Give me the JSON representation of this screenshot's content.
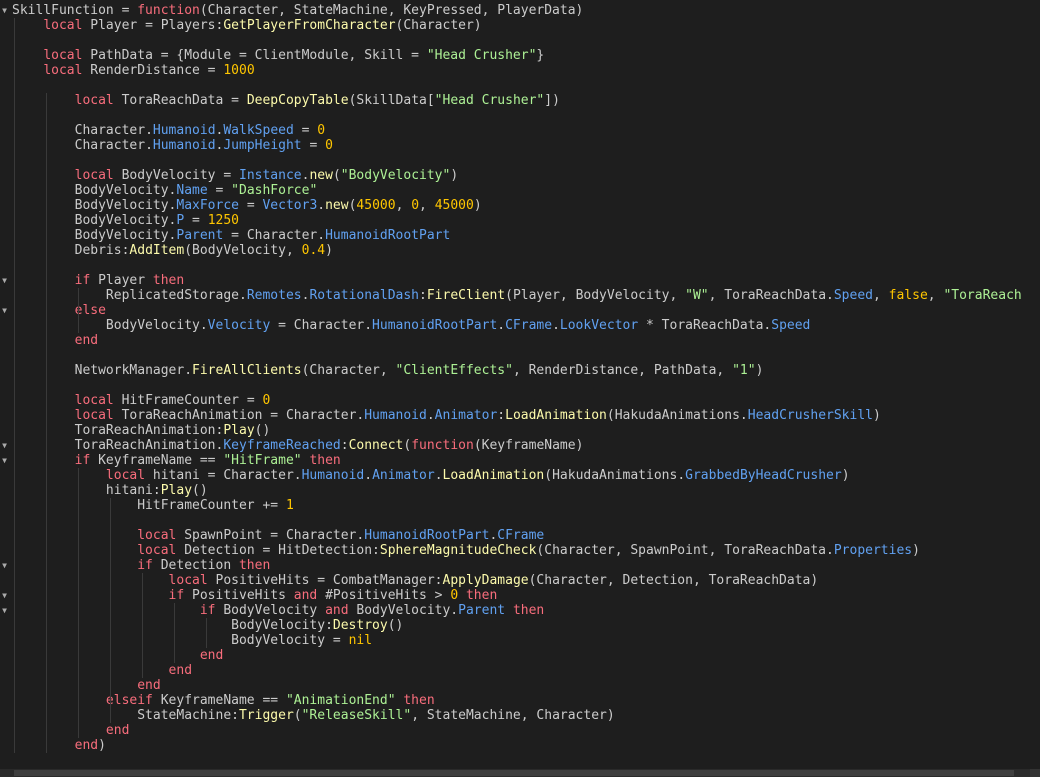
{
  "editor": {
    "colors": {
      "background": "#1e1e1e",
      "text": "#cccccc",
      "keyword": "#f86d7c",
      "function": "#fdfbac",
      "property": "#61a1f1",
      "string": "#adf195",
      "number": "#ffc600"
    },
    "fold_icon": "fold-arrow-icon",
    "lines": [
      {
        "indent": 0,
        "fold": true,
        "tokens": [
          [
            "SkillFunction = ",
            "t"
          ],
          [
            "function",
            "k"
          ],
          [
            "(Character, StateMachine, KeyPressed, PlayerData)",
            "t"
          ]
        ]
      },
      {
        "indent": 1,
        "tokens": [
          [
            "local",
            "k"
          ],
          [
            " Player = Players:",
            "t"
          ],
          [
            "GetPlayerFromCharacter",
            "f"
          ],
          [
            "(Character)",
            "t"
          ]
        ]
      },
      {
        "indent": 0,
        "tokens": []
      },
      {
        "indent": 1,
        "tokens": [
          [
            "local",
            "k"
          ],
          [
            " PathData = {Module = ClientModule, Skill = ",
            "t"
          ],
          [
            "\"Head Crusher\"",
            "s"
          ],
          [
            "}",
            "t"
          ]
        ]
      },
      {
        "indent": 1,
        "tokens": [
          [
            "local",
            "k"
          ],
          [
            " RenderDistance = ",
            "t"
          ],
          [
            "1000",
            "n"
          ]
        ]
      },
      {
        "indent": 0,
        "tokens": []
      },
      {
        "indent": 2,
        "tokens": [
          [
            "local",
            "k"
          ],
          [
            " ToraReachData = ",
            "t"
          ],
          [
            "DeepCopyTable",
            "f"
          ],
          [
            "(SkillData[",
            "t"
          ],
          [
            "\"Head Crusher\"",
            "s"
          ],
          [
            "])",
            "t"
          ]
        ]
      },
      {
        "indent": 0,
        "tokens": []
      },
      {
        "indent": 2,
        "tokens": [
          [
            "Character.",
            "t"
          ],
          [
            "Humanoid",
            "p"
          ],
          [
            ".",
            "t"
          ],
          [
            "WalkSpeed",
            "p"
          ],
          [
            " = ",
            "t"
          ],
          [
            "0",
            "n"
          ]
        ]
      },
      {
        "indent": 2,
        "tokens": [
          [
            "Character.",
            "t"
          ],
          [
            "Humanoid",
            "p"
          ],
          [
            ".",
            "t"
          ],
          [
            "JumpHeight",
            "p"
          ],
          [
            " = ",
            "t"
          ],
          [
            "0",
            "n"
          ]
        ]
      },
      {
        "indent": 0,
        "tokens": []
      },
      {
        "indent": 2,
        "tokens": [
          [
            "local",
            "k"
          ],
          [
            " BodyVelocity = ",
            "t"
          ],
          [
            "Instance",
            "p"
          ],
          [
            ".",
            "t"
          ],
          [
            "new",
            "f"
          ],
          [
            "(",
            "t"
          ],
          [
            "\"BodyVelocity\"",
            "s"
          ],
          [
            ")",
            "t"
          ]
        ]
      },
      {
        "indent": 2,
        "tokens": [
          [
            "BodyVelocity.",
            "t"
          ],
          [
            "Name",
            "p"
          ],
          [
            " = ",
            "t"
          ],
          [
            "\"DashForce\"",
            "s"
          ]
        ]
      },
      {
        "indent": 2,
        "tokens": [
          [
            "BodyVelocity.",
            "t"
          ],
          [
            "MaxForce",
            "p"
          ],
          [
            " = ",
            "t"
          ],
          [
            "Vector3",
            "p"
          ],
          [
            ".",
            "t"
          ],
          [
            "new",
            "f"
          ],
          [
            "(",
            "t"
          ],
          [
            "45000",
            "n"
          ],
          [
            ", ",
            "t"
          ],
          [
            "0",
            "n"
          ],
          [
            ", ",
            "t"
          ],
          [
            "45000",
            "n"
          ],
          [
            ")",
            "t"
          ]
        ]
      },
      {
        "indent": 2,
        "tokens": [
          [
            "BodyVelocity.",
            "t"
          ],
          [
            "P",
            "p"
          ],
          [
            " = ",
            "t"
          ],
          [
            "1250",
            "n"
          ]
        ]
      },
      {
        "indent": 2,
        "tokens": [
          [
            "BodyVelocity.",
            "t"
          ],
          [
            "Parent",
            "p"
          ],
          [
            " = Character.",
            "t"
          ],
          [
            "HumanoidRootPart",
            "p"
          ]
        ]
      },
      {
        "indent": 2,
        "tokens": [
          [
            "Debris:",
            "t"
          ],
          [
            "AddItem",
            "f"
          ],
          [
            "(BodyVelocity, ",
            "t"
          ],
          [
            "0.4",
            "n"
          ],
          [
            ")",
            "t"
          ]
        ]
      },
      {
        "indent": 0,
        "tokens": []
      },
      {
        "indent": 2,
        "fold": true,
        "tokens": [
          [
            "if",
            "k"
          ],
          [
            " Player ",
            "t"
          ],
          [
            "then",
            "k"
          ]
        ]
      },
      {
        "indent": 3,
        "tokens": [
          [
            "ReplicatedStorage.",
            "t"
          ],
          [
            "Remotes",
            "p"
          ],
          [
            ".",
            "t"
          ],
          [
            "RotationalDash",
            "p"
          ],
          [
            ":",
            "t"
          ],
          [
            "FireClient",
            "f"
          ],
          [
            "(Player, BodyVelocity, ",
            "t"
          ],
          [
            "\"W\"",
            "s"
          ],
          [
            ", ToraReachData.",
            "t"
          ],
          [
            "Speed",
            "p"
          ],
          [
            ", ",
            "t"
          ],
          [
            "false",
            "n"
          ],
          [
            ", ",
            "t"
          ],
          [
            "\"ToraReach",
            "s"
          ]
        ]
      },
      {
        "indent": 2,
        "fold": true,
        "tokens": [
          [
            "else",
            "k"
          ]
        ]
      },
      {
        "indent": 3,
        "tokens": [
          [
            "BodyVelocity.",
            "t"
          ],
          [
            "Velocity",
            "p"
          ],
          [
            " = Character.",
            "t"
          ],
          [
            "HumanoidRootPart",
            "p"
          ],
          [
            ".",
            "t"
          ],
          [
            "CFrame",
            "p"
          ],
          [
            ".",
            "t"
          ],
          [
            "LookVector",
            "p"
          ],
          [
            " * ToraReachData.",
            "t"
          ],
          [
            "Speed",
            "p"
          ]
        ]
      },
      {
        "indent": 2,
        "tokens": [
          [
            "end",
            "k"
          ]
        ]
      },
      {
        "indent": 0,
        "tokens": []
      },
      {
        "indent": 2,
        "tokens": [
          [
            "NetworkManager.",
            "t"
          ],
          [
            "FireAllClients",
            "f"
          ],
          [
            "(Character, ",
            "t"
          ],
          [
            "\"ClientEffects\"",
            "s"
          ],
          [
            ", RenderDistance, PathData, ",
            "t"
          ],
          [
            "\"1\"",
            "s"
          ],
          [
            ")",
            "t"
          ]
        ]
      },
      {
        "indent": 0,
        "tokens": []
      },
      {
        "indent": 2,
        "tokens": [
          [
            "local",
            "k"
          ],
          [
            " HitFrameCounter = ",
            "t"
          ],
          [
            "0",
            "n"
          ]
        ]
      },
      {
        "indent": 2,
        "tokens": [
          [
            "local",
            "k"
          ],
          [
            " ToraReachAnimation = Character.",
            "t"
          ],
          [
            "Humanoid",
            "p"
          ],
          [
            ".",
            "t"
          ],
          [
            "Animator",
            "p"
          ],
          [
            ":",
            "t"
          ],
          [
            "LoadAnimation",
            "f"
          ],
          [
            "(HakudaAnimations.",
            "t"
          ],
          [
            "HeadCrusherSkill",
            "p"
          ],
          [
            ")",
            "t"
          ]
        ]
      },
      {
        "indent": 2,
        "tokens": [
          [
            "ToraReachAnimation:",
            "t"
          ],
          [
            "Play",
            "f"
          ],
          [
            "()",
            "t"
          ]
        ]
      },
      {
        "indent": 2,
        "fold": true,
        "tokens": [
          [
            "ToraReachAnimation.",
            "t"
          ],
          [
            "KeyframeReached",
            "p"
          ],
          [
            ":",
            "t"
          ],
          [
            "Connect",
            "f"
          ],
          [
            "(",
            "t"
          ],
          [
            "function",
            "k"
          ],
          [
            "(KeyframeName)",
            "t"
          ]
        ]
      },
      {
        "indent": 2,
        "fold": true,
        "tokens": [
          [
            "if",
            "k"
          ],
          [
            " KeyframeName == ",
            "t"
          ],
          [
            "\"HitFrame\"",
            "s"
          ],
          [
            " ",
            "t"
          ],
          [
            "then",
            "k"
          ]
        ]
      },
      {
        "indent": 3,
        "tokens": [
          [
            "local",
            "k"
          ],
          [
            " hitani = Character.",
            "t"
          ],
          [
            "Humanoid",
            "p"
          ],
          [
            ".",
            "t"
          ],
          [
            "Animator",
            "p"
          ],
          [
            ".",
            "t"
          ],
          [
            "LoadAnimation",
            "f"
          ],
          [
            "(HakudaAnimations.",
            "t"
          ],
          [
            "GrabbedByHeadCrusher",
            "p"
          ],
          [
            ")",
            "t"
          ]
        ]
      },
      {
        "indent": 3,
        "tokens": [
          [
            "hitani:",
            "t"
          ],
          [
            "Play",
            "f"
          ],
          [
            "()",
            "t"
          ]
        ]
      },
      {
        "indent": 4,
        "tokens": [
          [
            "HitFrameCounter += ",
            "t"
          ],
          [
            "1",
            "n"
          ]
        ]
      },
      {
        "indent": 0,
        "tokens": []
      },
      {
        "indent": 4,
        "tokens": [
          [
            "local",
            "k"
          ],
          [
            " SpawnPoint = Character.",
            "t"
          ],
          [
            "HumanoidRootPart",
            "p"
          ],
          [
            ".",
            "t"
          ],
          [
            "CFrame",
            "p"
          ]
        ]
      },
      {
        "indent": 4,
        "tokens": [
          [
            "local",
            "k"
          ],
          [
            " Detection = HitDetection:",
            "t"
          ],
          [
            "SphereMagnitudeCheck",
            "f"
          ],
          [
            "(Character, SpawnPoint, ToraReachData.",
            "t"
          ],
          [
            "Properties",
            "p"
          ],
          [
            ")",
            "t"
          ]
        ]
      },
      {
        "indent": 4,
        "fold": true,
        "tokens": [
          [
            "if",
            "k"
          ],
          [
            " Detection ",
            "t"
          ],
          [
            "then",
            "k"
          ]
        ]
      },
      {
        "indent": 5,
        "tokens": [
          [
            "local",
            "k"
          ],
          [
            " PositiveHits = CombatManager:",
            "t"
          ],
          [
            "ApplyDamage",
            "f"
          ],
          [
            "(Character, Detection, ToraReachData)",
            "t"
          ]
        ]
      },
      {
        "indent": 5,
        "fold": true,
        "tokens": [
          [
            "if",
            "k"
          ],
          [
            " PositiveHits ",
            "t"
          ],
          [
            "and",
            "k"
          ],
          [
            " #PositiveHits > ",
            "t"
          ],
          [
            "0",
            "n"
          ],
          [
            " ",
            "t"
          ],
          [
            "then",
            "k"
          ]
        ]
      },
      {
        "indent": 6,
        "fold": true,
        "tokens": [
          [
            "if",
            "k"
          ],
          [
            " BodyVelocity ",
            "t"
          ],
          [
            "and",
            "k"
          ],
          [
            " BodyVelocity.",
            "t"
          ],
          [
            "Parent",
            "p"
          ],
          [
            " ",
            "t"
          ],
          [
            "then",
            "k"
          ]
        ]
      },
      {
        "indent": 7,
        "tokens": [
          [
            "BodyVelocity:",
            "t"
          ],
          [
            "Destroy",
            "f"
          ],
          [
            "()",
            "t"
          ]
        ]
      },
      {
        "indent": 7,
        "tokens": [
          [
            "BodyVelocity = ",
            "t"
          ],
          [
            "nil",
            "n"
          ]
        ]
      },
      {
        "indent": 6,
        "tokens": [
          [
            "end",
            "k"
          ]
        ]
      },
      {
        "indent": 5,
        "tokens": [
          [
            "end",
            "k"
          ]
        ]
      },
      {
        "indent": 4,
        "tokens": [
          [
            "end",
            "k"
          ]
        ]
      },
      {
        "indent": 3,
        "tokens": [
          [
            "elseif",
            "k"
          ],
          [
            " KeyframeName == ",
            "t"
          ],
          [
            "\"AnimationEnd\"",
            "s"
          ],
          [
            " ",
            "t"
          ],
          [
            "then",
            "k"
          ]
        ]
      },
      {
        "indent": 4,
        "tokens": [
          [
            "StateMachine:",
            "t"
          ],
          [
            "Trigger",
            "f"
          ],
          [
            "(",
            "t"
          ],
          [
            "\"ReleaseSkill\"",
            "s"
          ],
          [
            ", StateMachine, Character)",
            "t"
          ]
        ]
      },
      {
        "indent": 3,
        "tokens": [
          [
            "end",
            "k"
          ]
        ]
      },
      {
        "indent": 2,
        "tokens": [
          [
            "end",
            "k"
          ],
          [
            ")",
            "t"
          ]
        ]
      }
    ]
  }
}
